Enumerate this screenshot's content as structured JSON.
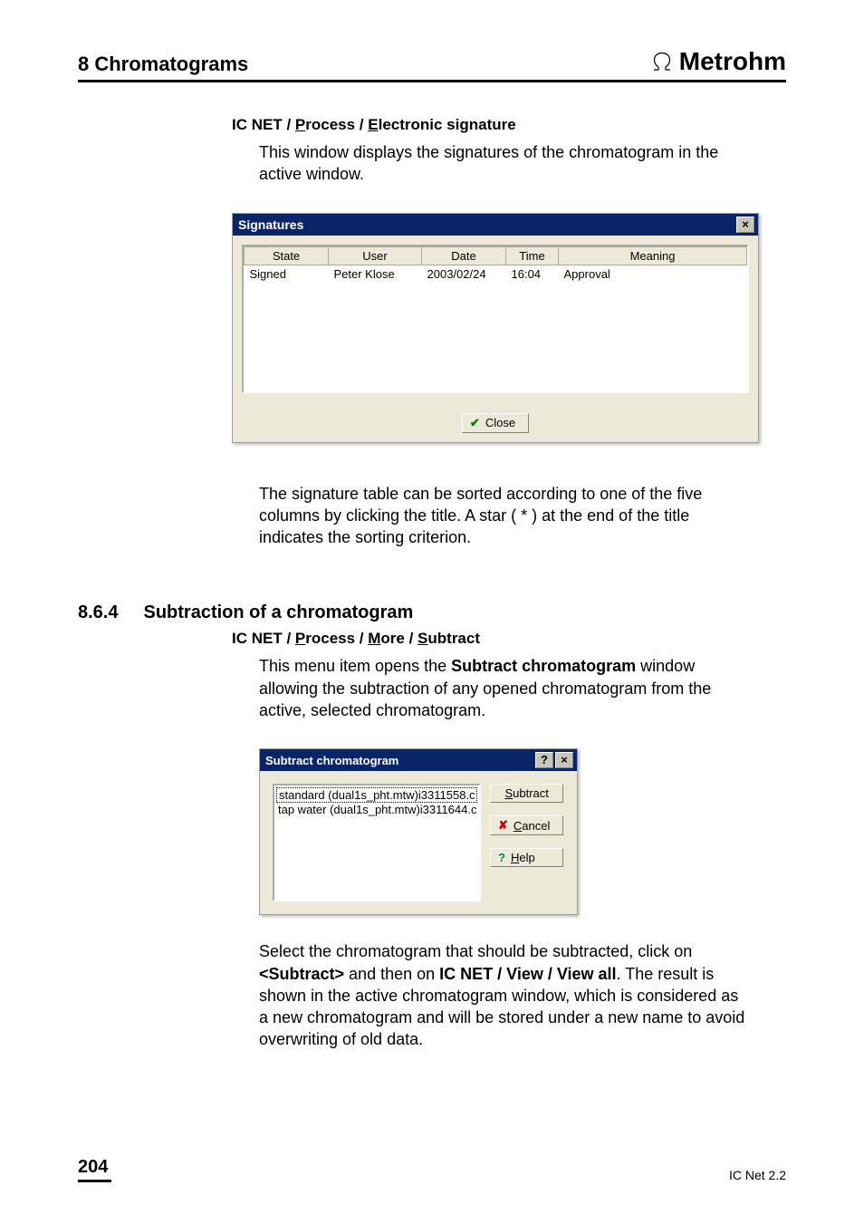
{
  "header": {
    "chapter": "8  Chromatograms",
    "brand": "Metrohm"
  },
  "bc1": {
    "app": "IC NET",
    "sep": " / ",
    "m1": "Process",
    "m2": "Electronic signature"
  },
  "intro1": "This window displays the signatures of the chromatogram in the active window.",
  "sigWindow": {
    "title": "Signatures",
    "close_x": "×",
    "columns": {
      "state": "State",
      "user": "User",
      "date": "Date",
      "time": "Time",
      "meaning": "Meaning"
    },
    "row": {
      "state": "Signed",
      "user": "Peter Klose",
      "date": "2003/02/24",
      "time": "16:04",
      "meaning": "Approval"
    },
    "closeBtn": "Close"
  },
  "para1": "The signature table can be sorted according to one of the five columns by clicking the title. A star ( * ) at the end of the title indicates the sorting criterion.",
  "section": {
    "num": "8.6.4",
    "title": "Subtraction of a chromatogram"
  },
  "bc2": {
    "app": "IC NET",
    "m1": "Process",
    "m2": "More",
    "m3": "Subtract"
  },
  "para2a": "This menu item opens the ",
  "para2b": "Subtract chromatogram",
  "para2c": " window allowing the subtraction of any opened chromatogram from the active, selected chromatogram.",
  "subWindow": {
    "title": "Subtract chromatogram",
    "help_q": "?",
    "close_x": "×",
    "item0": "standard (dual1s_pht.mtw)i3311558.c",
    "item1": "tap water (dual1s_pht.mtw)i3311644.c",
    "btnSubtract": "Subtract",
    "btnCancel": "Cancel",
    "btnHelp": "Help"
  },
  "para3": {
    "a": "Select the chromatogram that should be subtracted, click on ",
    "b": "<Subtract>",
    "c": " and then on ",
    "d": "IC NET / View / View all",
    "e": ". The result is shown in the active chromatogram window, which is considered as a new chromatogram and will be stored under a new name to avoid overwriting of old data."
  },
  "footer": {
    "page": "204",
    "product": "IC Net 2.2"
  }
}
